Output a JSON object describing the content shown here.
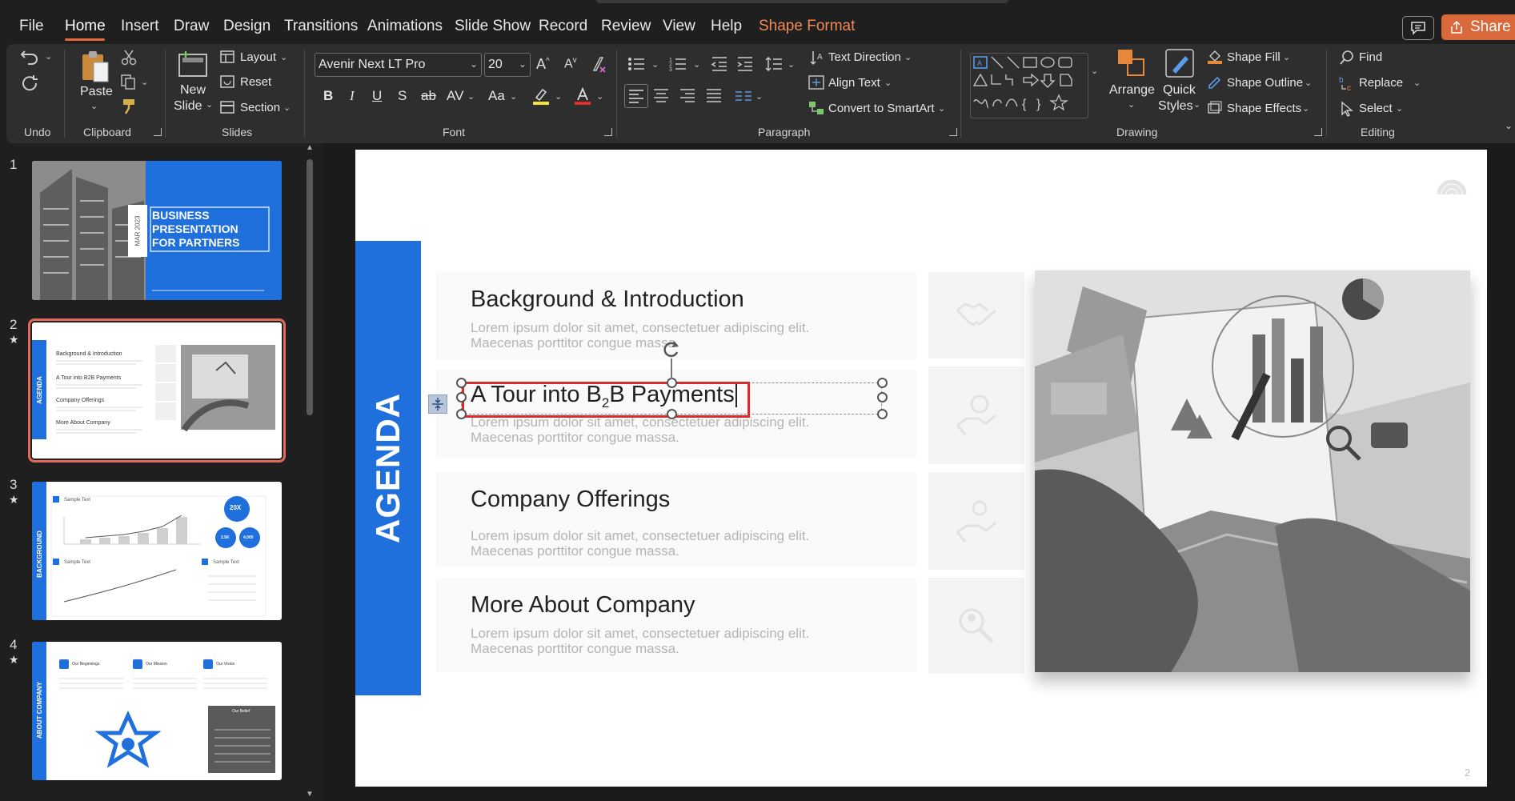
{
  "menu": {
    "items": [
      "File",
      "Home",
      "Insert",
      "Draw",
      "Design",
      "Transitions",
      "Animations",
      "Slide Show",
      "Record",
      "Review",
      "View",
      "Help",
      "Shape Format"
    ],
    "active": "Home",
    "share_label": "Share"
  },
  "ribbon": {
    "undo_group": "Undo",
    "clipboard": {
      "paste": "Paste",
      "group": "Clipboard"
    },
    "slides": {
      "new_slide_line1": "New",
      "new_slide_line2": "Slide",
      "layout": "Layout",
      "reset": "Reset",
      "section": "Section",
      "group": "Slides"
    },
    "font": {
      "font_name": "Avenir Next LT Pro",
      "font_size": "20",
      "group": "Font"
    },
    "paragraph": {
      "text_direction": "Text Direction",
      "align_text": "Align Text",
      "convert_smartart": "Convert to SmartArt",
      "group": "Paragraph"
    },
    "drawing": {
      "arrange": "Arrange",
      "quick_styles_line1": "Quick",
      "quick_styles_line2": "Styles",
      "shape_fill": "Shape Fill",
      "shape_outline": "Shape Outline",
      "shape_effects": "Shape Effects",
      "group": "Drawing"
    },
    "editing": {
      "find": "Find",
      "replace": "Replace",
      "select": "Select",
      "group": "Editing"
    }
  },
  "thumbnails": [
    {
      "num": "1",
      "star": "",
      "lines": [
        "BUSINESS",
        "PRESENTATION",
        "FOR PARTNERS"
      ],
      "side_label": "MAR 2023"
    },
    {
      "num": "2",
      "star": "★",
      "side_label": "AGENDA",
      "items": [
        "Background & Introduction",
        "A Tour into B2B Payments",
        "Company Offerings",
        "More About Company"
      ]
    },
    {
      "num": "3",
      "star": "★",
      "side_label": "BACKGROUND",
      "headers": [
        "Sample Text",
        "Sample Text",
        "Sample Text"
      ],
      "badges": [
        "20X",
        "2.5K",
        "4,000"
      ]
    },
    {
      "num": "4",
      "star": "★",
      "side_label": "ABOUT COMPANY",
      "headers": [
        "Our Beginnings",
        "Our Mission",
        "Our Vision",
        "Our Belief"
      ]
    }
  ],
  "slide": {
    "agenda_label": "AGENDA",
    "items": [
      {
        "title": "Background & Introduction",
        "desc_line1": "Lorem ipsum dolor sit amet, consectetuer adipiscing elit.",
        "desc_line2": "Maecenas porttitor congue massa."
      },
      {
        "title_pre": "A Tour into B",
        "title_sub": "2",
        "title_post": "B Payments",
        "desc_line1": "Lorem ipsum dolor sit amet, consectetuer adipiscing elit.",
        "desc_line2": "Maecenas porttitor congue massa."
      },
      {
        "title": "Company Offerings",
        "desc_line1": "Lorem ipsum dolor sit amet, consectetuer adipiscing elit.",
        "desc_line2": "Maecenas porttitor congue massa."
      },
      {
        "title": "More About Company",
        "desc_line1": "Lorem ipsum dolor sit amet, consectetuer adipiscing elit.",
        "desc_line2": "Maecenas porttitor congue massa."
      }
    ],
    "page_number": "2"
  },
  "colors": {
    "accent": "#1f6fdc",
    "share": "#d9683a",
    "highlight": "#d92b2b"
  }
}
